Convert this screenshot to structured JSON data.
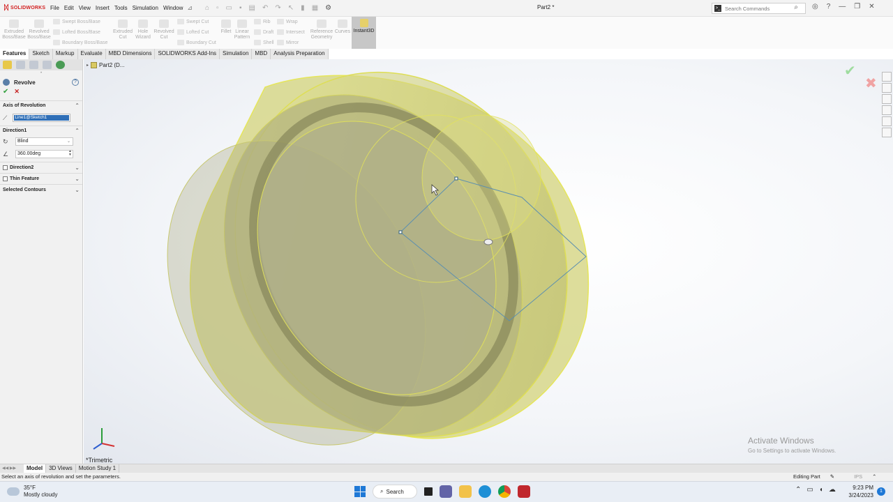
{
  "app": {
    "logo_text": "SOLIDWORKS",
    "doc_title": "Part2 *"
  },
  "menu": [
    "File",
    "Edit",
    "View",
    "Insert",
    "Tools",
    "Simulation",
    "Window"
  ],
  "search": {
    "placeholder": "Search Commands"
  },
  "ribbon": {
    "extruded_boss": "Extruded\nBoss/Base",
    "revolved_boss": "Revolved\nBoss/Base",
    "swept_boss": "Swept Boss/Base",
    "lofted_boss": "Lofted Boss/Base",
    "boundary_boss": "Boundary Boss/Base",
    "extruded_cut": "Extruded\nCut",
    "hole_wizard": "Hole\nWizard",
    "revolved_cut": "Revolved\nCut",
    "swept_cut": "Swept Cut",
    "lofted_cut": "Lofted Cut",
    "boundary_cut": "Boundary Cut",
    "fillet": "Fillet",
    "linear_pattern": "Linear\nPattern",
    "rib": "Rib",
    "draft": "Draft",
    "shell": "Shell",
    "wrap": "Wrap",
    "intersect": "Intersect",
    "mirror": "Mirror",
    "reference_geometry": "Reference\nGeometry",
    "curves": "Curves",
    "instant3d": "Instant3D"
  },
  "tabs": [
    "Features",
    "Sketch",
    "Markup",
    "Evaluate",
    "MBD Dimensions",
    "SOLIDWORKS Add-Ins",
    "Simulation",
    "MBD",
    "Analysis Preparation"
  ],
  "property_manager": {
    "title": "Revolve",
    "help": "?",
    "axis_section": "Axis of Revolution",
    "axis_value": "Line1@Sketch1",
    "direction1": "Direction1",
    "end_condition": "Blind",
    "angle": "360.00deg",
    "direction2": "Direction2",
    "thin_feature": "Thin Feature",
    "selected_contours": "Selected Contours"
  },
  "tree": {
    "part": "Part2 (D..."
  },
  "viewport": {
    "view_name": "*Trimetric",
    "activate_title": "Activate Windows",
    "activate_sub": "Go to Settings to activate Windows."
  },
  "bottom_tabs": [
    "Model",
    "3D Views",
    "Motion Study 1"
  ],
  "status": {
    "message": "Select an axis of revolution and set the parameters.",
    "mode": "Editing Part",
    "units": "IPS"
  },
  "taskbar": {
    "temp": "35°F",
    "weather": "Mostly cloudy",
    "search": "Search",
    "time": "9:23 PM",
    "date": "3/24/2023",
    "notif_count": "1"
  },
  "colors": {
    "accent": "#2f6fb7",
    "brand": "#d21f1f",
    "model_face": "#d8d87a",
    "sketch_line": "#5b8fb0"
  }
}
